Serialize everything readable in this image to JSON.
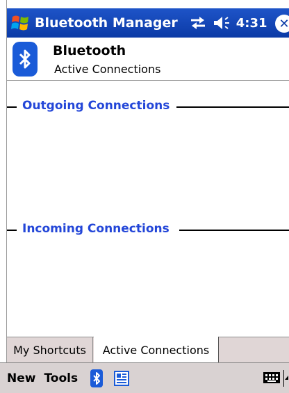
{
  "titlebar": {
    "app_title": "Bluetooth Manager",
    "time": "4:31",
    "start_icon": "windows-flag-icon",
    "sync_icon": "sync-arrows-icon",
    "volume_icon": "speaker-icon",
    "close_icon": "close-icon",
    "close_glyph": "✕"
  },
  "header": {
    "title": "Bluetooth",
    "subtitle": "Active Connections",
    "icon": "bluetooth-icon"
  },
  "sections": {
    "outgoing": "Outgoing Connections",
    "incoming": "Incoming Connections"
  },
  "tabs": [
    {
      "label": "My Shortcuts",
      "active": false
    },
    {
      "label": "Active Connections",
      "active": true
    }
  ],
  "menubar": {
    "new_label": "New",
    "tools_label": "Tools",
    "bluetooth_icon": "bluetooth-icon",
    "document_icon": "document-icon",
    "keyboard_icon": "keyboard-icon"
  },
  "colors": {
    "titlebar": "#0b3aa6",
    "section_label": "#2346d8",
    "tab_bar": "#e0d6d6",
    "bluetooth_blue": "#1a5bd8"
  }
}
